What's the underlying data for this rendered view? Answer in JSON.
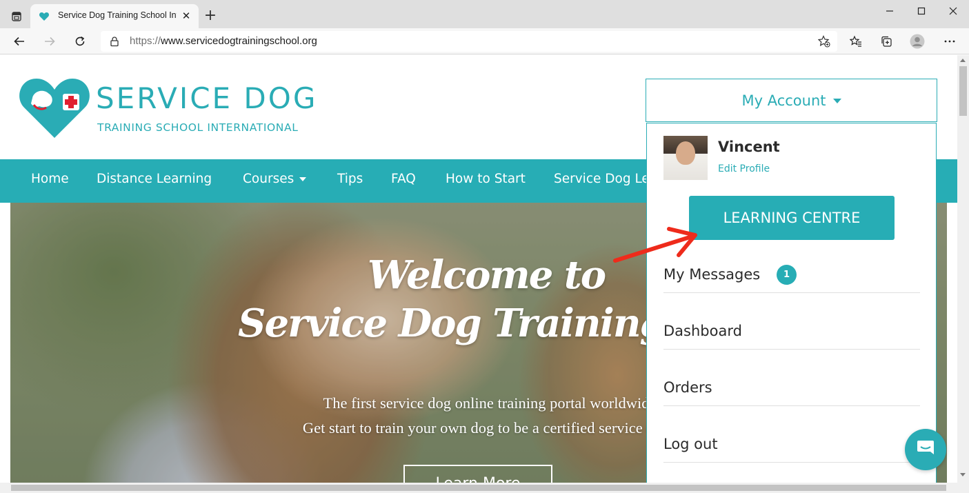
{
  "browser": {
    "tab_title": "Service Dog Training School Inte",
    "tab_close": "✕",
    "new_tab": "+",
    "url_prefix": "https://",
    "url_host": "www.servicedogtrainingschool.org",
    "icons": [
      "tab-actions-icon",
      "favicon-heart-icon",
      "back-icon",
      "forward-icon",
      "refresh-icon",
      "lock-icon",
      "add-favorite-icon",
      "favorites-icon",
      "collections-icon",
      "profile-icon",
      "more-icon",
      "minimize-icon",
      "maximize-icon",
      "close-icon"
    ]
  },
  "site": {
    "brand_color": "#2aacb5",
    "logo": {
      "title": "SERVICE DOG",
      "subtitle": "TRAINING SCHOOL INTERNATIONAL"
    },
    "account_button": "My Account",
    "nav": {
      "home": "Home",
      "distance": "Distance Learning",
      "courses": "Courses",
      "tips": "Tips",
      "faq": "FAQ",
      "how": "How to Start",
      "sdl": "Service Dog Le"
    },
    "hero": {
      "title_line1": "Welcome to",
      "title_line2": "Service Dog Training Schoo",
      "line1": "The first service dog online training portal worldwid",
      "line2": "Get start to train your own dog to be a certified service dog",
      "cta": "Learn More"
    },
    "dropdown": {
      "user_name": "Vincent",
      "edit_profile": "Edit Profile",
      "learning_centre": "LEARNING CENTRE",
      "messages": "My Messages",
      "messages_count": "1",
      "dashboard": "Dashboard",
      "orders": "Orders",
      "logout": "Log out"
    }
  }
}
